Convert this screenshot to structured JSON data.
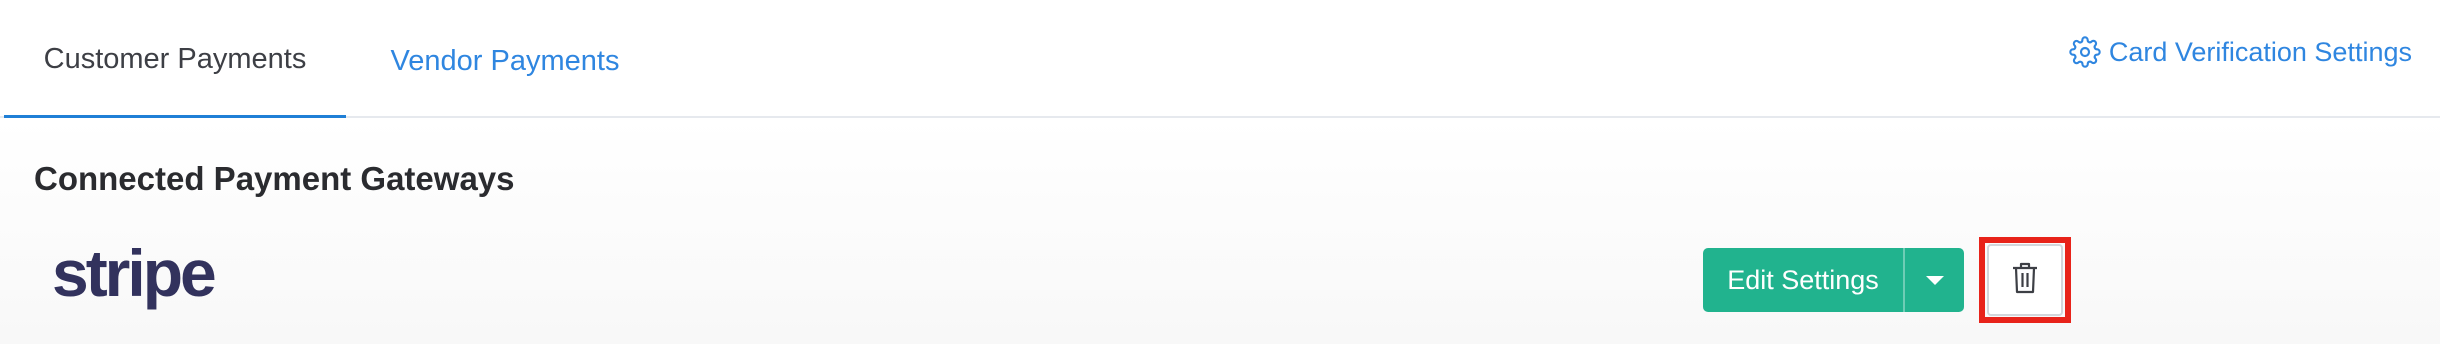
{
  "tabs": {
    "customer_label": "Customer Payments",
    "vendor_label": "Vendor Payments"
  },
  "header_link": {
    "label": "Card Verification Settings",
    "icon": "gear-icon"
  },
  "section": {
    "title": "Connected Payment Gateways"
  },
  "gateway": {
    "logo_text": "stripe",
    "edit_label": "Edit Settings",
    "delete_icon": "trash-icon"
  },
  "colors": {
    "accent_blue": "#2f86e0",
    "tab_underline": "#1f7fd6",
    "button_green": "#21b38e",
    "highlight_red": "#e8231a",
    "stripe_navy": "#32325d"
  }
}
